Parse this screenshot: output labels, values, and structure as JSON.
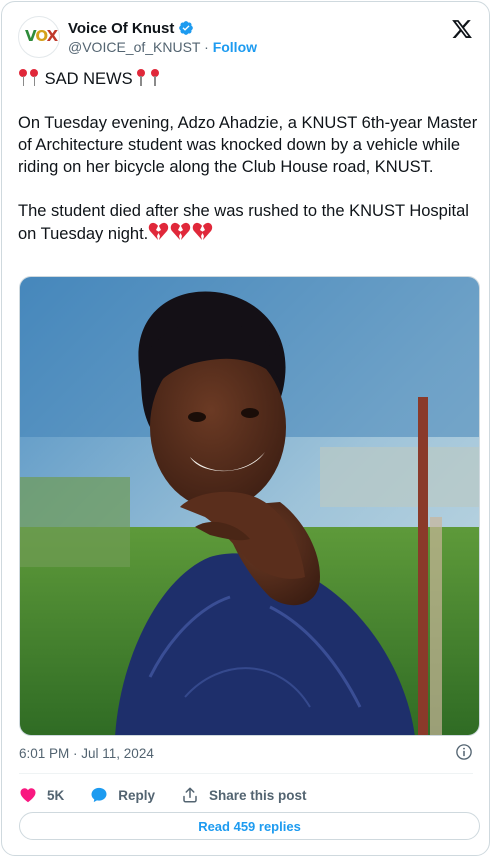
{
  "author": {
    "name": "Voice Of Knust",
    "handle": "@VOICE_of_KNUST",
    "separator": "·",
    "follow_label": "Follow",
    "avatar_text_v": "V",
    "avatar_text_o": "O",
    "avatar_text_x": "X",
    "verified": true
  },
  "post": {
    "headline": "SAD NEWS",
    "paragraph1": "On Tuesday evening, Adzo Ahadzie, a KNUST 6th-year Master of Architecture student was knocked down by a vehicle while riding on her bicycle along the Club House road, KNUST.",
    "paragraph2": "The student died after she was rushed to the KNUST Hospital on Tuesday night.",
    "timestamp": "6:01 PM · Jul 11, 2024"
  },
  "actions": {
    "likes": "5K",
    "reply_label": "Reply",
    "share_label": "Share this post"
  },
  "read_replies_label": "Read 459 replies",
  "colors": {
    "accent": "#1d9bf0",
    "heart": "#f91880",
    "text": "#0f1419",
    "muted": "#536471",
    "border": "#cfd9de"
  },
  "icons": [
    "verified-badge-icon",
    "x-logo-icon",
    "pin-icon",
    "broken-heart-icon",
    "info-icon",
    "heart-icon",
    "reply-bubble-icon",
    "share-icon"
  ]
}
